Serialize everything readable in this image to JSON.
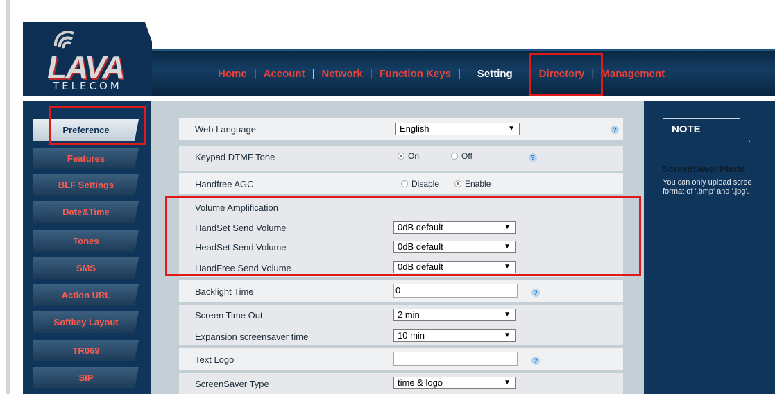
{
  "brand": {
    "logo": "LAVA",
    "sub": "TELECOM"
  },
  "nav": [
    "Home",
    "Account",
    "Network",
    "Function Keys",
    "Setting",
    "Directory",
    "Management"
  ],
  "sidebar": [
    "Preference",
    "Features",
    "BLF Settings",
    "Date&Time",
    "Tones",
    "SMS",
    "Action URL",
    "Softkey Layout",
    "TR069",
    "SIP"
  ],
  "settings": {
    "web_language": {
      "label": "Web Language",
      "value": "English"
    },
    "keypad_dtmf": {
      "label": "Keypad DTMF Tone",
      "on": "On",
      "off": "Off",
      "selected": "On"
    },
    "handfree_agc": {
      "label": "Handfree AGC",
      "disable": "Disable",
      "enable": "Enable",
      "selected": "Enable"
    },
    "volume_amplification": {
      "label": "Volume Amplification"
    },
    "handset_send": {
      "label": "HandSet Send Volume",
      "value": "0dB default"
    },
    "headset_send": {
      "label": "HeadSet Send Volume",
      "value": "0dB default"
    },
    "handfree_send": {
      "label": "HandFree Send Volume",
      "value": "0dB default"
    },
    "backlight_time": {
      "label": "Backlight Time",
      "value": "0"
    },
    "screen_time_out": {
      "label": "Screen Time Out",
      "value": "2 min"
    },
    "expansion_screensaver": {
      "label": "Expansion screensaver time",
      "value": "10 min"
    },
    "text_logo": {
      "label": "Text Logo",
      "value": ""
    },
    "screensaver_type": {
      "label": "ScreenSaver Type",
      "value": "time & logo"
    }
  },
  "help_symbol": "?",
  "select_arrow": "▼",
  "note": {
    "tab": "NOTE",
    "title": "ScreenSaver Photo",
    "lines": [
      "You can only upload scree",
      "format of '.bmp' and '.jpg'."
    ]
  },
  "colors": {
    "navy": "#0f355a",
    "highlight": "#e0191a",
    "nav_text": "#e8423a"
  }
}
